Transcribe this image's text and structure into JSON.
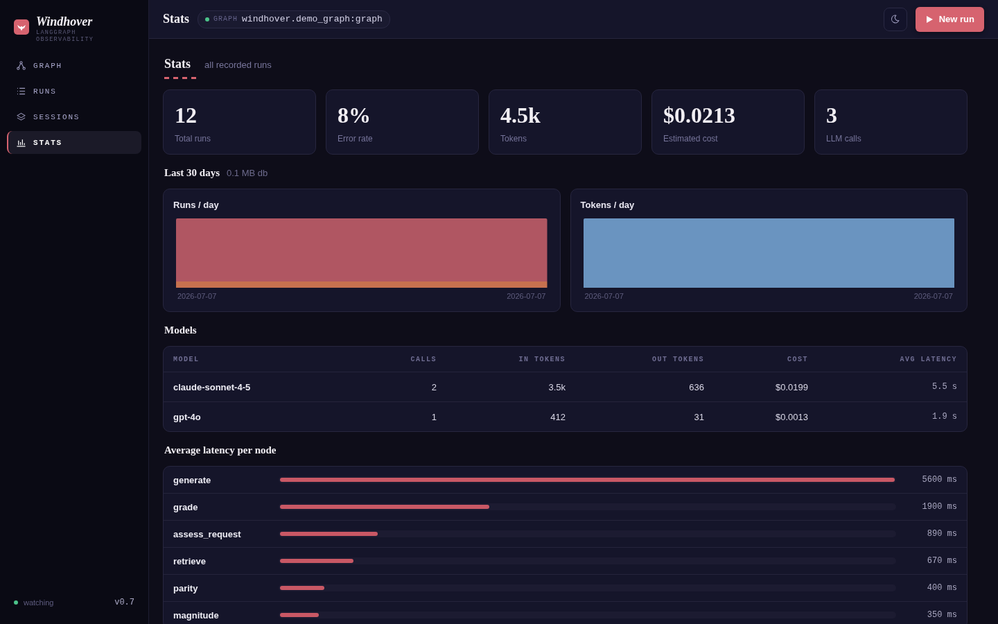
{
  "sidebar": {
    "brand": {
      "name": "Windhover",
      "tagline": "LANGGRAPH OBSERVABILITY"
    },
    "nav": [
      {
        "label": "GRAPH",
        "selected": false
      },
      {
        "label": "RUNS",
        "selected": false
      },
      {
        "label": "SESSIONS",
        "selected": false
      },
      {
        "label": "STATS",
        "selected": true
      }
    ],
    "watcher": {
      "label": "watching",
      "active": true
    },
    "version": "v0.7"
  },
  "topbar": {
    "title": "Stats",
    "graph": {
      "label": "GRAPH",
      "value": "windhover.demo_graph:graph",
      "connected": true
    },
    "run_button": {
      "label": "New run"
    }
  },
  "header": {
    "title": "Stats",
    "subtitle": "all recorded runs"
  },
  "stat_cards": [
    {
      "value": "12",
      "label": "Total runs"
    },
    {
      "value": "8%",
      "label": "Error rate"
    },
    {
      "value": "4.5k",
      "label": "Tokens"
    },
    {
      "value": "$0.0213",
      "label": "Estimated cost"
    },
    {
      "value": "3",
      "label": "LLM calls"
    }
  ],
  "period": {
    "title": "Last 30 days",
    "note": "0.1 MB db"
  },
  "charts": [
    {
      "kind": "runs",
      "title": "Runs / day",
      "x_start": "2026-07-07",
      "x_end": "2026-07-07"
    },
    {
      "kind": "tokens",
      "title": "Tokens / day",
      "x_start": "2026-07-07",
      "x_end": "2026-07-07"
    }
  ],
  "models": {
    "title": "Models",
    "columns": [
      "MODEL",
      "CALLS",
      "IN TOKENS",
      "OUT TOKENS",
      "COST",
      "AVG LATENCY"
    ],
    "rows": [
      [
        "claude-sonnet-4-5",
        "2",
        "3.5k",
        "636",
        "$0.0199",
        "5.5 s"
      ],
      [
        "gpt-4o",
        "1",
        "412",
        "31",
        "$0.0013",
        "1.9 s"
      ]
    ]
  },
  "latency": {
    "title": "Average latency per node",
    "rows": [
      {
        "node": "generate",
        "level": 1,
        "reading": "5600 ms"
      },
      {
        "node": "grade",
        "level": 0.34,
        "reading": "1900 ms"
      },
      {
        "node": "assess_request",
        "level": 0.159,
        "reading": "890 ms"
      },
      {
        "node": "retrieve",
        "level": 0.12,
        "reading": "670 ms"
      },
      {
        "node": "parity",
        "level": 0.072,
        "reading": "400 ms"
      },
      {
        "node": "magnitude",
        "level": 0.063,
        "reading": "350 ms"
      }
    ]
  }
}
